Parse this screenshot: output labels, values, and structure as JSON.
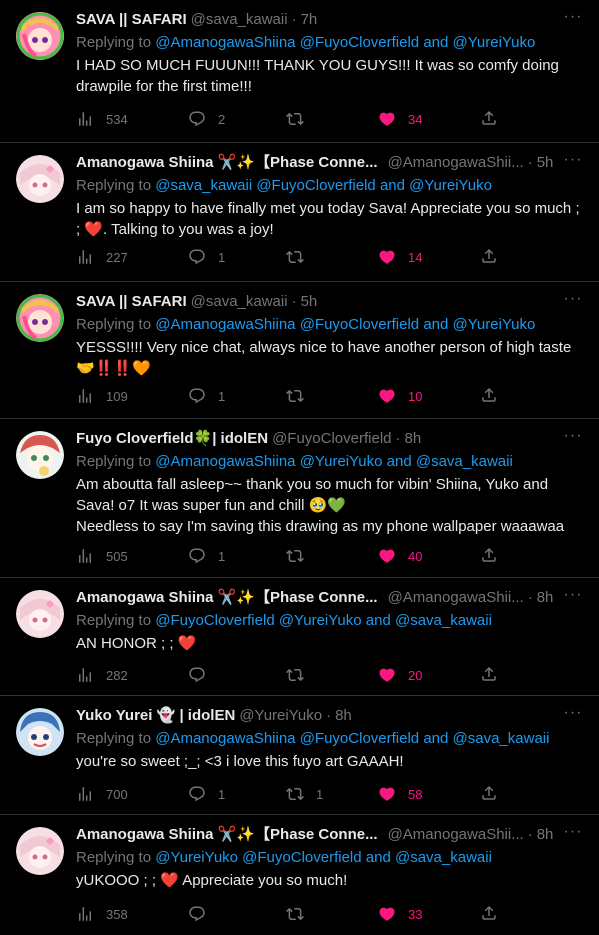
{
  "colors": {
    "bg": "#000000",
    "text": "#e7e9ea",
    "muted": "#71767b",
    "link": "#1d9bf0",
    "like": "#f91880"
  },
  "tweets": [
    {
      "name": "SAVA || SAFARI",
      "handle": "@sava_kawaii",
      "time": "7h",
      "reply_prefix": "Replying to",
      "mentions": [
        "@AmanogawaShiina",
        "@FuyoCloverfield",
        "and",
        "@YureiYuko"
      ],
      "text": "I HAD SO MUCH FUUUN!!! THANK YOU GUYS!!! It was so comfy doing drawpile for the first time!!!",
      "views": "534",
      "replies": "2",
      "retweets": "",
      "likes": "34"
    },
    {
      "name": "Amanogawa Shiina ✂️✨【Phase Conne...",
      "handle": "@AmanogawaShii...",
      "time": "5h",
      "reply_prefix": "Replying to",
      "mentions": [
        "@sava_kawaii",
        "@FuyoCloverfield",
        "and",
        "@YureiYuko"
      ],
      "text": "I am so happy to have finally met you today Sava! Appreciate you so much ; ; ❤️. Talking to you was a joy!",
      "views": "227",
      "replies": "1",
      "retweets": "",
      "likes": "14"
    },
    {
      "name": "SAVA || SAFARI",
      "handle": "@sava_kawaii",
      "time": "5h",
      "reply_prefix": "Replying to",
      "mentions": [
        "@AmanogawaShiina",
        "@FuyoCloverfield",
        "and",
        "@YureiYuko"
      ],
      "text": "YESSS!!!! Very nice chat, always nice to have another person of high taste 🤝‼️‼️🧡",
      "views": "109",
      "replies": "1",
      "retweets": "",
      "likes": "10"
    },
    {
      "name": "Fuyo Cloverfield🍀| idolEN",
      "handle": "@FuyoCloverfield",
      "time": "8h",
      "reply_prefix": "Replying to",
      "mentions": [
        "@AmanogawaShiina",
        "@YureiYuko",
        "and",
        "@sava_kawaii"
      ],
      "text": "Am aboutta fall asleep~~ thank you so much for vibin' Shiina, Yuko and Sava! o7 It was super fun and chill 🥹💚\nNeedless to say I'm saving this drawing as my phone wallpaper waaawaa",
      "views": "505",
      "replies": "1",
      "retweets": "",
      "likes": "40"
    },
    {
      "name": "Amanogawa Shiina ✂️✨【Phase Conne...",
      "handle": "@AmanogawaShii...",
      "time": "8h",
      "reply_prefix": "Replying to",
      "mentions": [
        "@FuyoCloverfield",
        "@YureiYuko",
        "and",
        "@sava_kawaii"
      ],
      "text": "AN HONOR ; ; ❤️",
      "views": "282",
      "replies": "",
      "retweets": "",
      "likes": "20"
    },
    {
      "name": "Yuko Yurei 👻 | idolEN",
      "handle": "@YureiYuko",
      "time": "8h",
      "reply_prefix": "Replying to",
      "mentions": [
        "@AmanogawaShiina",
        "@FuyoCloverfield",
        "and",
        "@sava_kawaii"
      ],
      "text": "you're so sweet ;_; <3 i love this fuyo art GAAAH!",
      "views": "700",
      "replies": "1",
      "retweets": "1",
      "likes": "58"
    },
    {
      "name": "Amanogawa Shiina ✂️✨【Phase Conne...",
      "handle": "@AmanogawaShii...",
      "time": "8h",
      "reply_prefix": "Replying to",
      "mentions": [
        "@YureiYuko",
        "@FuyoCloverfield",
        "and",
        "@sava_kawaii"
      ],
      "text": "yUKOOO ; ; ❤️ Appreciate you so much!",
      "views": "358",
      "replies": "",
      "retweets": "",
      "likes": "33"
    }
  ]
}
